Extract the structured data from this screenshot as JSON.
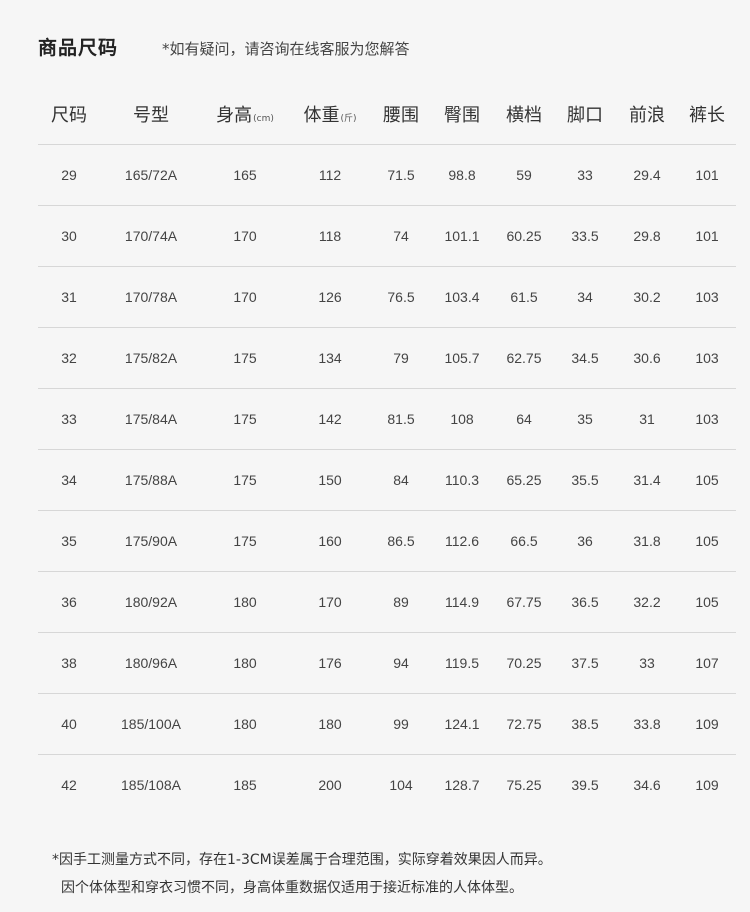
{
  "header": {
    "title": "商品尺码",
    "note": "*如有疑问，请咨询在线客服为您解答"
  },
  "table": {
    "columns": [
      {
        "label": "尺码",
        "unit": ""
      },
      {
        "label": "号型",
        "unit": ""
      },
      {
        "label": "身高",
        "unit": "(cm)"
      },
      {
        "label": "体重",
        "unit": "(斤)"
      },
      {
        "label": "腰围",
        "unit": ""
      },
      {
        "label": "臀围",
        "unit": ""
      },
      {
        "label": "横档",
        "unit": ""
      },
      {
        "label": "脚口",
        "unit": ""
      },
      {
        "label": "前浪",
        "unit": ""
      },
      {
        "label": "裤长",
        "unit": ""
      }
    ],
    "rows": [
      [
        "29",
        "165/72A",
        "165",
        "112",
        "71.5",
        "98.8",
        "59",
        "33",
        "29.4",
        "101"
      ],
      [
        "30",
        "170/74A",
        "170",
        "118",
        "74",
        "101.1",
        "60.25",
        "33.5",
        "29.8",
        "101"
      ],
      [
        "31",
        "170/78A",
        "170",
        "126",
        "76.5",
        "103.4",
        "61.5",
        "34",
        "30.2",
        "103"
      ],
      [
        "32",
        "175/82A",
        "175",
        "134",
        "79",
        "105.7",
        "62.75",
        "34.5",
        "30.6",
        "103"
      ],
      [
        "33",
        "175/84A",
        "175",
        "142",
        "81.5",
        "108",
        "64",
        "35",
        "31",
        "103"
      ],
      [
        "34",
        "175/88A",
        "175",
        "150",
        "84",
        "110.3",
        "65.25",
        "35.5",
        "31.4",
        "105"
      ],
      [
        "35",
        "175/90A",
        "175",
        "160",
        "86.5",
        "112.6",
        "66.5",
        "36",
        "31.8",
        "105"
      ],
      [
        "36",
        "180/92A",
        "180",
        "170",
        "89",
        "114.9",
        "67.75",
        "36.5",
        "32.2",
        "105"
      ],
      [
        "38",
        "180/96A",
        "180",
        "176",
        "94",
        "119.5",
        "70.25",
        "37.5",
        "33",
        "107"
      ],
      [
        "40",
        "185/100A",
        "180",
        "180",
        "99",
        "124.1",
        "72.75",
        "38.5",
        "33.8",
        "109"
      ],
      [
        "42",
        "185/108A",
        "185",
        "200",
        "104",
        "128.7",
        "75.25",
        "39.5",
        "34.6",
        "109"
      ]
    ]
  },
  "footer": {
    "line1": "*因手工测量方式不同，存在1-3CM误差属于合理范围，实际穿着效果因人而异。",
    "line2": "因个体体型和穿衣习惯不同，身高体重数据仅适用于接近标准的人体体型。"
  }
}
